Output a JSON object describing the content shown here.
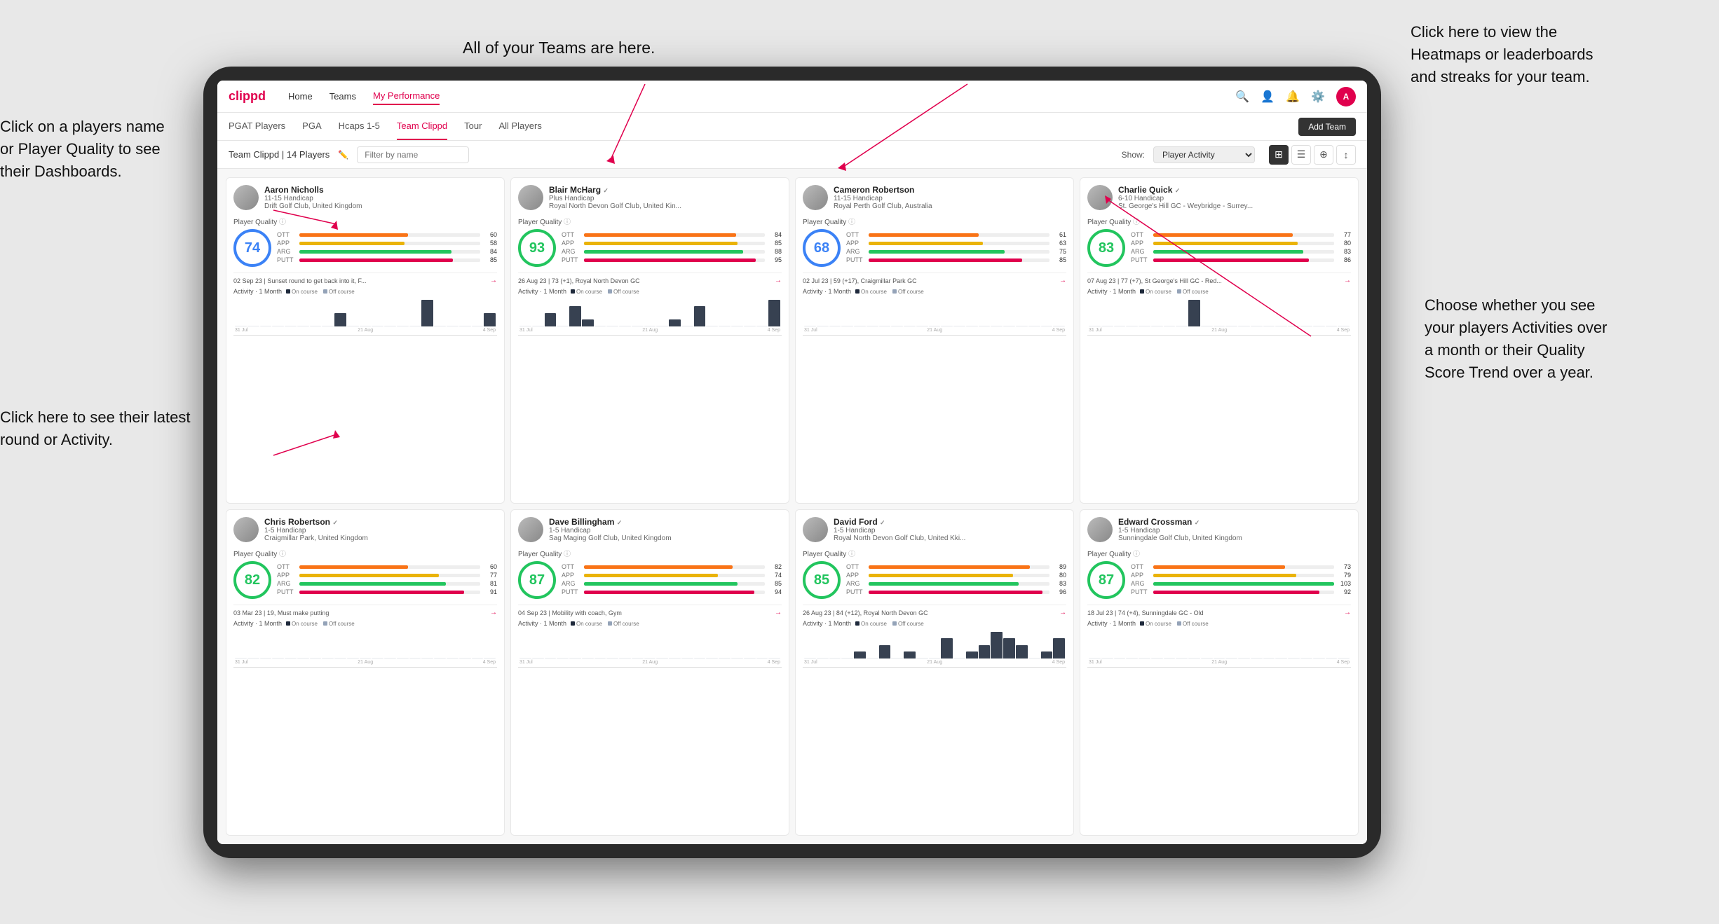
{
  "annotations": {
    "teams_label": "All of your Teams are here.",
    "heatmaps_label": "Click here to view the\nHeatmaps or leaderboards\nand streaks for your team.",
    "players_name_label": "Click on a players name\nor Player Quality to see\ntheir Dashboards.",
    "latest_round_label": "Click here to see their latest\nround or Activity.",
    "activities_label": "Choose whether you see\nyour players Activities over\na month or their Quality\nScore Trend over a year."
  },
  "nav": {
    "logo": "clippd",
    "links": [
      "Home",
      "Teams",
      "My Performance"
    ],
    "icons": [
      "🔍",
      "👤",
      "🔔",
      "⚙",
      "👤"
    ]
  },
  "sub_nav": {
    "tabs": [
      "PGAT Players",
      "PGA",
      "Hcaps 1-5",
      "Team Clippd",
      "Tour",
      "All Players"
    ],
    "active": "Team Clippd",
    "add_team": "Add Team"
  },
  "team_header": {
    "title": "Team Clippd | 14 Players",
    "filter_placeholder": "Filter by name",
    "show_label": "Show:",
    "show_value": "Player Activity"
  },
  "players": [
    {
      "name": "Aaron Nicholls",
      "handicap": "11-15 Handicap",
      "club": "Drift Golf Club, United Kingdom",
      "quality": 74,
      "quality_color": "blue",
      "ott": 60,
      "app": 58,
      "arg": 84,
      "putt": 85,
      "latest_round": "02 Sep 23 | Sunset round to get back into it, F...",
      "bars": [
        0,
        0,
        0,
        0,
        0,
        0,
        0,
        0,
        1,
        0,
        0,
        0,
        0,
        0,
        0,
        2,
        0,
        0,
        0,
        0,
        1
      ],
      "x_labels": [
        "31 Jul",
        "21 Aug",
        "4 Sep"
      ]
    },
    {
      "name": "Blair McHarg",
      "handicap": "Plus Handicap",
      "club": "Royal North Devon Golf Club, United Kin...",
      "quality": 93,
      "quality_color": "green",
      "ott": 84,
      "app": 85,
      "arg": 88,
      "putt": 95,
      "latest_round": "26 Aug 23 | 73 (+1), Royal North Devon GC",
      "bars": [
        0,
        0,
        2,
        0,
        3,
        1,
        0,
        0,
        0,
        0,
        0,
        0,
        1,
        0,
        3,
        0,
        0,
        0,
        0,
        0,
        4
      ],
      "x_labels": [
        "31 Jul",
        "21 Aug",
        "4 Sep"
      ]
    },
    {
      "name": "Cameron Robertson",
      "handicap": "11-15 Handicap",
      "club": "Royal Perth Golf Club, Australia",
      "quality": 68,
      "quality_color": "blue",
      "ott": 61,
      "app": 63,
      "arg": 75,
      "putt": 85,
      "latest_round": "02 Jul 23 | 59 (+17), Craigmillar Park GC",
      "bars": [
        0,
        0,
        0,
        0,
        0,
        0,
        0,
        0,
        0,
        0,
        0,
        0,
        0,
        0,
        0,
        0,
        0,
        0,
        0,
        0,
        0
      ],
      "x_labels": [
        "31 Jul",
        "21 Aug",
        "4 Sep"
      ]
    },
    {
      "name": "Charlie Quick",
      "handicap": "6-10 Handicap",
      "club": "St. George's Hill GC - Weybridge - Surrey...",
      "quality": 83,
      "quality_color": "green",
      "ott": 77,
      "app": 80,
      "arg": 83,
      "putt": 86,
      "latest_round": "07 Aug 23 | 77 (+7), St George's Hill GC - Red...",
      "bars": [
        0,
        0,
        0,
        0,
        0,
        0,
        0,
        0,
        1,
        0,
        0,
        0,
        0,
        0,
        0,
        0,
        0,
        0,
        0,
        0,
        0
      ],
      "x_labels": [
        "31 Jul",
        "21 Aug",
        "4 Sep"
      ]
    },
    {
      "name": "Chris Robertson",
      "handicap": "1-5 Handicap",
      "club": "Craigmillar Park, United Kingdom",
      "quality": 82,
      "quality_color": "green",
      "ott": 60,
      "app": 77,
      "arg": 81,
      "putt": 91,
      "latest_round": "03 Mar 23 | 19, Must make putting",
      "bars": [
        0,
        0,
        0,
        0,
        0,
        0,
        0,
        0,
        0,
        0,
        0,
        0,
        0,
        0,
        0,
        0,
        0,
        0,
        0,
        0,
        0
      ],
      "x_labels": [
        "31 Jul",
        "21 Aug",
        "4 Sep"
      ]
    },
    {
      "name": "Dave Billingham",
      "handicap": "1-5 Handicap",
      "club": "Sag Maging Golf Club, United Kingdom",
      "quality": 87,
      "quality_color": "green",
      "ott": 82,
      "app": 74,
      "arg": 85,
      "putt": 94,
      "latest_round": "04 Sep 23 | Mobility with coach, Gym",
      "bars": [
        0,
        0,
        0,
        0,
        0,
        0,
        0,
        0,
        0,
        0,
        0,
        0,
        0,
        0,
        0,
        0,
        0,
        0,
        0,
        0,
        0
      ],
      "x_labels": [
        "31 Jul",
        "21 Aug",
        "4 Sep"
      ]
    },
    {
      "name": "David Ford",
      "handicap": "1-5 Handicap",
      "club": "Royal North Devon Golf Club, United Kki...",
      "quality": 85,
      "quality_color": "green",
      "ott": 89,
      "app": 80,
      "arg": 83,
      "putt": 96,
      "latest_round": "26 Aug 23 | 84 (+12), Royal North Devon GC",
      "bars": [
        0,
        0,
        0,
        0,
        1,
        0,
        2,
        0,
        1,
        0,
        0,
        3,
        0,
        1,
        2,
        4,
        3,
        2,
        0,
        1,
        3
      ],
      "x_labels": [
        "31 Jul",
        "21 Aug",
        "4 Sep"
      ]
    },
    {
      "name": "Edward Crossman",
      "handicap": "1-5 Handicap",
      "club": "Sunningdale Golf Club, United Kingdom",
      "quality": 87,
      "quality_color": "green",
      "ott": 73,
      "app": 79,
      "arg": 103,
      "putt": 92,
      "latest_round": "18 Jul 23 | 74 (+4), Sunningdale GC - Old",
      "bars": [
        0,
        0,
        0,
        0,
        0,
        0,
        0,
        0,
        0,
        0,
        0,
        0,
        0,
        0,
        0,
        0,
        0,
        0,
        0,
        0,
        0
      ],
      "x_labels": [
        "31 Jul",
        "21 Aug",
        "4 Sep"
      ]
    }
  ]
}
